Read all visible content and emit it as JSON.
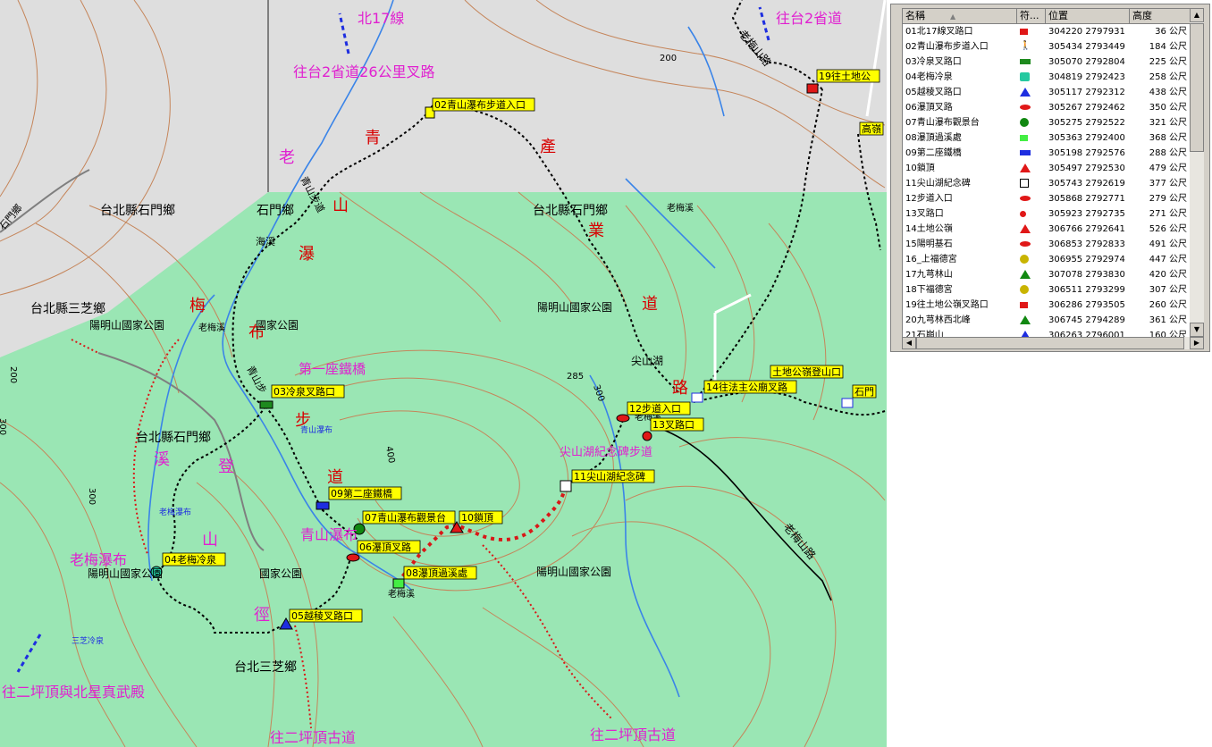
{
  "map": {
    "road_labels": [
      {
        "id": "bei17",
        "text": "北17線"
      },
      {
        "id": "to-tai2",
        "text": "往台2省道"
      },
      {
        "id": "to-tai2-26k",
        "text": "往台2省道26公里叉路"
      },
      {
        "id": "to-erpingding-beixing",
        "text": "往二坪頂與北星真武殿"
      },
      {
        "id": "to-erpingding-1",
        "text": "往二坪頂古道"
      },
      {
        "id": "to-erpingding-2",
        "text": "往二坪頂古道"
      },
      {
        "id": "laomeiroad",
        "text": "老梅山路"
      },
      {
        "id": "laomeiroad-2",
        "text": "老梅山路"
      }
    ],
    "route_chars": {
      "left": [
        "老",
        "青",
        "山",
        "瀑",
        "梅",
        "布",
        "步",
        "道"
      ],
      "right": [
        "產",
        "業",
        "道",
        "路"
      ],
      "lower": [
        "溪",
        "登",
        "山",
        "徑"
      ]
    },
    "place_labels": [
      {
        "id": "shimen-1",
        "text": "台北縣石門鄉"
      },
      {
        "id": "shimen-2",
        "text": "台北縣石門鄉"
      },
      {
        "id": "shimen-3",
        "text": "台北縣石門鄉"
      },
      {
        "id": "shimen-4",
        "text": "石門鄉"
      },
      {
        "id": "sanzhi-1",
        "text": "台北縣三芝鄉"
      },
      {
        "id": "sanzhi-2",
        "text": "台北三芝鄉"
      },
      {
        "id": "park-1",
        "text": "陽明山國家公園"
      },
      {
        "id": "park-2",
        "text": "陽明山國家公園"
      },
      {
        "id": "park-3",
        "text": "陽明山國家公園"
      },
      {
        "id": "park-4",
        "text": "陽明山國家公園"
      },
      {
        "id": "park-5",
        "text": "國家公園"
      },
      {
        "id": "park-6",
        "text": "國家公園"
      },
      {
        "id": "laomeixi-1",
        "text": "老梅溪"
      },
      {
        "id": "laomeixi-2",
        "text": "老梅溪"
      },
      {
        "id": "laomeixi-3",
        "text": "老梅溪"
      },
      {
        "id": "laomeixi-4",
        "text": "老梅溪"
      },
      {
        "id": "jianshanhu",
        "text": "尖山湖"
      },
      {
        "id": "qingshan-trail",
        "text": "青山步道"
      },
      {
        "id": "qingshan-trail-2",
        "text": "青山步"
      },
      {
        "id": "shimenjun",
        "text": "石門鄉"
      },
      {
        "id": "haixi",
        "text": "海溪"
      },
      {
        "id": "laomei-pubu-small",
        "text": "老梅瀑布"
      },
      {
        "id": "qingshan-pubu-small",
        "text": "青山瀑布"
      },
      {
        "id": "sanzhi-lengquan",
        "text": "三芝冷泉"
      }
    ],
    "feature_labels": [
      {
        "id": "first-bridge",
        "text": "第一座鐵橋"
      },
      {
        "id": "laomei-waterfall",
        "text": "老梅瀑布"
      },
      {
        "id": "qingshan-waterfall",
        "text": "青山瀑布"
      },
      {
        "id": "jianshanhu-trail",
        "text": "尖山湖紀念碑步道"
      }
    ],
    "contour_labels": [
      "200",
      "285",
      "300",
      "300",
      "400",
      "200",
      "300"
    ],
    "waypoint_tags": [
      {
        "id": "wp02",
        "text": "02青山瀑布步道入口"
      },
      {
        "id": "wp03",
        "text": "03冷泉叉路口"
      },
      {
        "id": "wp04",
        "text": "04老梅冷泉"
      },
      {
        "id": "wp05",
        "text": "05越稜叉路口"
      },
      {
        "id": "wp06",
        "text": "06瀑頂叉路"
      },
      {
        "id": "wp07",
        "text": "07青山瀑布觀景台"
      },
      {
        "id": "wp08",
        "text": "08瀑頂過溪處"
      },
      {
        "id": "wp09",
        "text": "09第二座鐵橋"
      },
      {
        "id": "wp10",
        "text": "10鎖頂"
      },
      {
        "id": "wp11",
        "text": "11尖山湖紀念碑"
      },
      {
        "id": "wp12",
        "text": "12步道入口"
      },
      {
        "id": "wp13",
        "text": "13叉路口"
      },
      {
        "id": "wp14",
        "text": "14往法主公廟叉路"
      },
      {
        "id": "wp19",
        "text": "19往土地公嶺"
      },
      {
        "id": "wp-tudigong",
        "text": "土地公嶺登山口"
      },
      {
        "id": "wp-gaoling",
        "text": "高嶺"
      },
      {
        "id": "wp-shiqi",
        "text": "石門"
      }
    ]
  },
  "waypoint_list": {
    "columns": [
      "名稱",
      "符...",
      "位置",
      "高度"
    ],
    "sort_indicator": "▲",
    "rows": [
      {
        "name": "01北17線叉路口",
        "symbol": "red-flag",
        "pos": "304220 2797931",
        "alt": "36 公尺"
      },
      {
        "name": "02青山瀑布步道入口",
        "symbol": "hiker",
        "pos": "305434 2793449",
        "alt": "184 公尺"
      },
      {
        "name": "03冷泉叉路口",
        "symbol": "green-rect",
        "pos": "305070 2792804",
        "alt": "225 公尺"
      },
      {
        "name": "04老梅冷泉",
        "symbol": "hot-spring",
        "pos": "304819 2792423",
        "alt": "258 公尺"
      },
      {
        "name": "05越稜叉路口",
        "symbol": "blue-triangle",
        "pos": "305117 2792312",
        "alt": "438 公尺"
      },
      {
        "name": "06瀑頂叉路",
        "symbol": "red-ellipse",
        "pos": "305267 2792462",
        "alt": "350 公尺"
      },
      {
        "name": "07青山瀑布觀景台",
        "symbol": "green-circle",
        "pos": "305275 2792522",
        "alt": "321 公尺"
      },
      {
        "name": "08瀑頂過溪處",
        "symbol": "green-flag",
        "pos": "305363 2792400",
        "alt": "368 公尺"
      },
      {
        "name": "09第二座鐵橋",
        "symbol": "blue-rect",
        "pos": "305198 2792576",
        "alt": "288 公尺"
      },
      {
        "name": "10鎖頂",
        "symbol": "red-triangle",
        "pos": "305497 2792530",
        "alt": "479 公尺"
      },
      {
        "name": "11尖山湖紀念碑",
        "symbol": "monument",
        "pos": "305743 2792619",
        "alt": "377 公尺"
      },
      {
        "name": "12步道入口",
        "symbol": "red-ellipse",
        "pos": "305868 2792771",
        "alt": "279 公尺"
      },
      {
        "name": "13叉路口",
        "symbol": "red-sun",
        "pos": "305923 2792735",
        "alt": "271 公尺"
      },
      {
        "name": "14土地公嶺",
        "symbol": "red-triangle",
        "pos": "306766 2792641",
        "alt": "526 公尺"
      },
      {
        "name": "15陽明基石",
        "symbol": "red-ellipse",
        "pos": "306853 2792833",
        "alt": "491 公尺"
      },
      {
        "name": "16_上福德宮",
        "symbol": "temple",
        "pos": "306955 2792974",
        "alt": "447 公尺"
      },
      {
        "name": "17九芎林山",
        "symbol": "green-triangle",
        "pos": "307078 2793830",
        "alt": "420 公尺"
      },
      {
        "name": "18下福德宮",
        "symbol": "temple",
        "pos": "306511 2793299",
        "alt": "307 公尺"
      },
      {
        "name": "19往土地公嶺叉路口",
        "symbol": "red-flag",
        "pos": "306286 2793505",
        "alt": "260 公尺"
      },
      {
        "name": "20九芎林西北峰",
        "symbol": "green-triangle",
        "pos": "306745 2794289",
        "alt": "361 公尺"
      },
      {
        "name": "21石崩山",
        "symbol": "blue-triangle",
        "pos": "306263 2796001",
        "alt": "160 公尺"
      }
    ]
  },
  "colors": {
    "park": "#9ae6b4",
    "outside": "#dedede",
    "contour": "#c5855a",
    "river": "#3a84e8",
    "trail_red": "#d81818",
    "magenta": "#e020d0",
    "route_red": "#d80000",
    "tag_bg": "#ffff00"
  }
}
